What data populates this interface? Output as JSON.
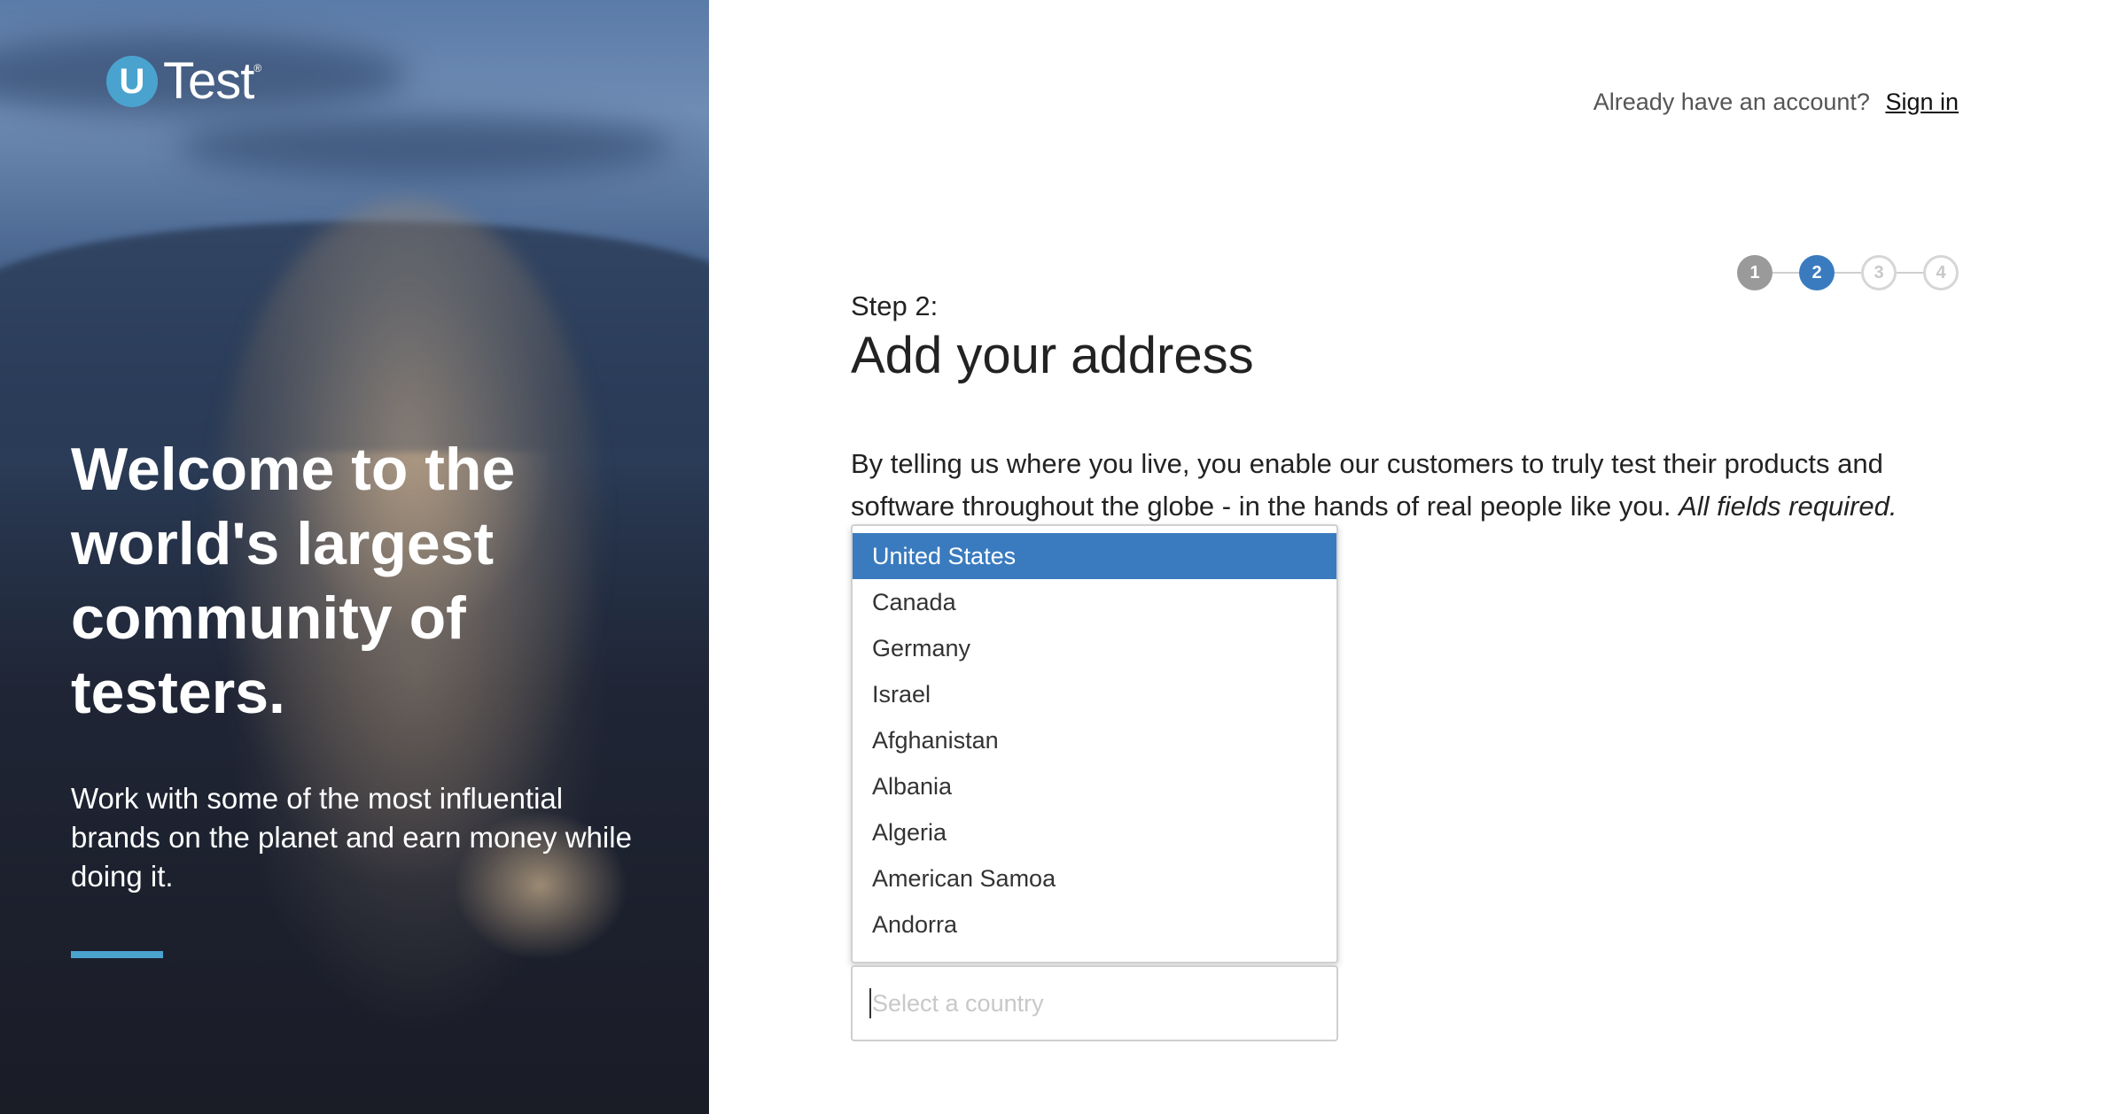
{
  "hero": {
    "logo_badge": "U",
    "logo_text": "Test",
    "logo_tm": "®",
    "headline": "Welcome to the world's largest community of testers.",
    "subtext": "Work with some of the most influential brands on the planet and earn money while doing it.",
    "accent_color": "#4aa3cf"
  },
  "header": {
    "account_prompt": "Already have an account?",
    "sign_in_label": "Sign in"
  },
  "stepper": {
    "steps": [
      "1",
      "2",
      "3",
      "4"
    ],
    "current": 2,
    "active_color": "#3a7bbf"
  },
  "form": {
    "step_label": "Step 2:",
    "title": "Add your address",
    "intro": "By telling us where you live, you enable our customers to truly test their products and software throughout the globe - in the hands of real people like you.",
    "intro_emphasis": "All fields required.",
    "country": {
      "placeholder": "Select a country",
      "selected": "United States",
      "options": [
        "United States",
        "Canada",
        "Germany",
        "Israel",
        "Afghanistan",
        "Albania",
        "Algeria",
        "American Samoa",
        "Andorra"
      ]
    }
  }
}
